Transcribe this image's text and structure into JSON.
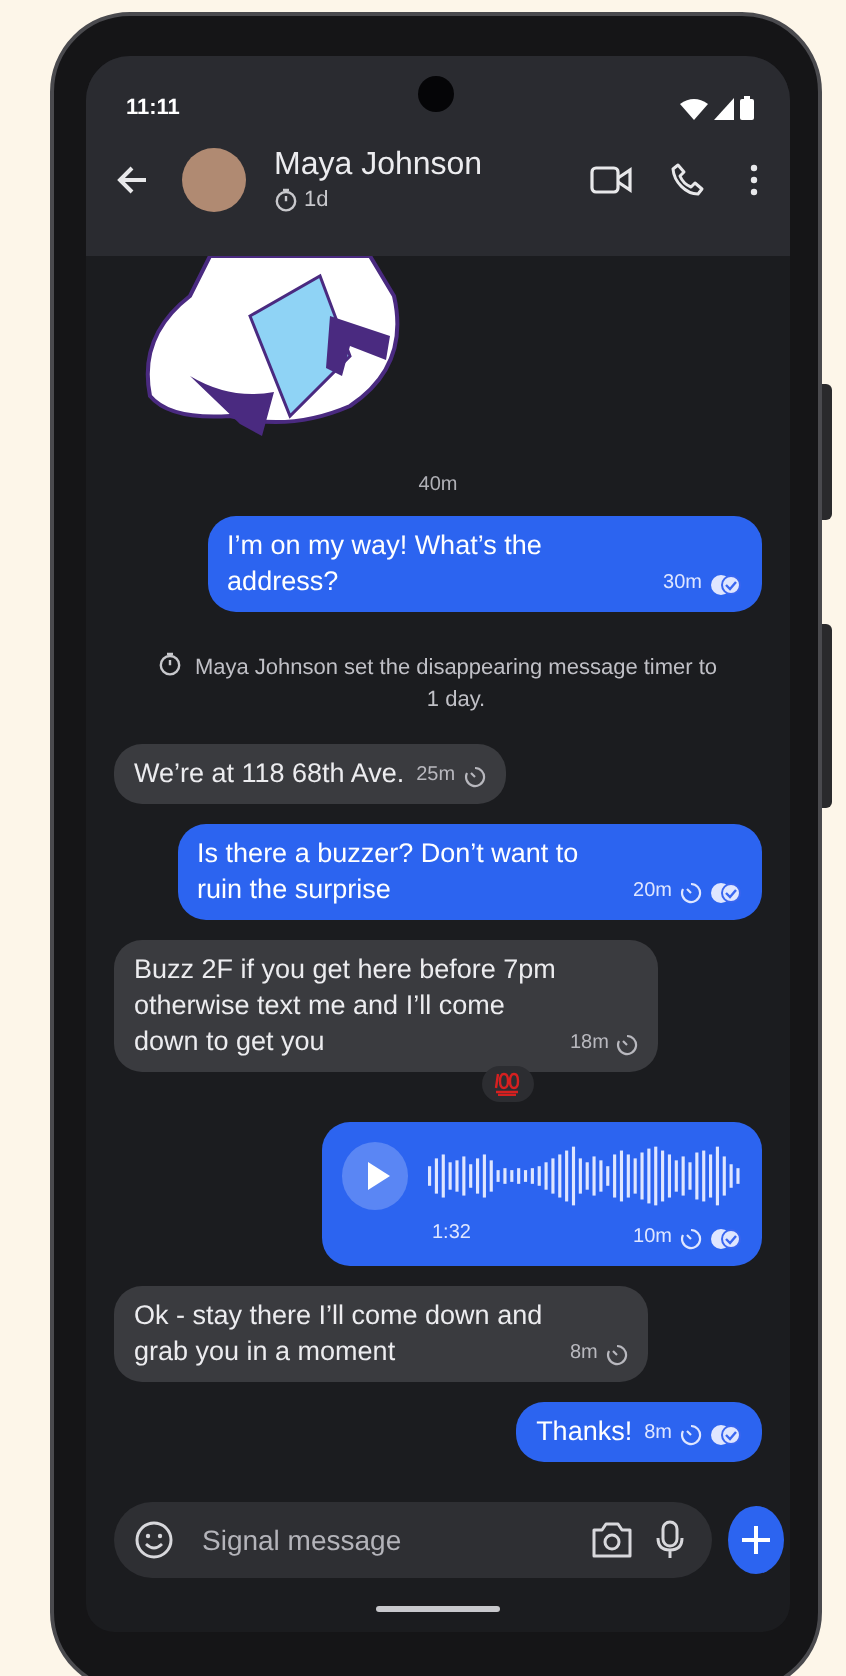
{
  "status_bar": {
    "time": "11:11"
  },
  "header": {
    "contact_name": "Maya Johnson",
    "timer": "1d"
  },
  "messages": [
    {
      "kind": "sticker"
    },
    {
      "kind": "divider",
      "text": "40m"
    },
    {
      "kind": "outgoing",
      "text": "I’m on my way! What’s the address?",
      "time": "30m",
      "timer": false,
      "read": true
    },
    {
      "kind": "system",
      "text": "Maya Johnson set the disappearing message timer to 1 day."
    },
    {
      "kind": "incoming",
      "text": "We’re at 118 68th Ave.",
      "time": "25m",
      "timer": true
    },
    {
      "kind": "outgoing",
      "text": "Is there a buzzer? Don’t want to ruin the surprise",
      "time": "20m",
      "timer": true,
      "read": true
    },
    {
      "kind": "incoming",
      "text": "Buzz 2F if you get here before 7pm otherwise text me and I’ll come down to get you",
      "time": "18m",
      "timer": true,
      "reaction": true
    },
    {
      "kind": "voice",
      "duration": "1:32",
      "time": "10m",
      "timer": true,
      "read": true
    },
    {
      "kind": "incoming",
      "text": "Ok - stay there I’ll come down and grab you in a moment",
      "time": "8m",
      "timer": true
    },
    {
      "kind": "outgoing",
      "text": "Thanks!",
      "time": "8m",
      "timer": true,
      "read": true
    }
  ],
  "composer": {
    "placeholder": "Signal message"
  }
}
